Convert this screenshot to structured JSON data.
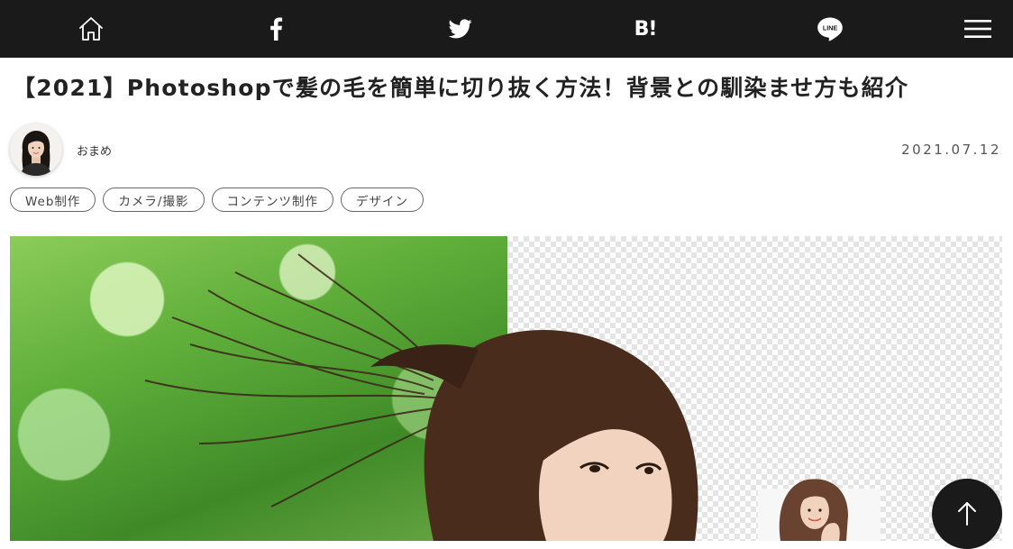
{
  "share_bar": {
    "background": "#1a1a1a",
    "items": [
      {
        "id": "home",
        "icon": "home-icon"
      },
      {
        "id": "facebook",
        "icon": "facebook-icon"
      },
      {
        "id": "twitter",
        "icon": "twitter-icon"
      },
      {
        "id": "hatena",
        "icon": "hatena-bookmark-icon",
        "label": "B!"
      },
      {
        "id": "line",
        "icon": "line-icon",
        "label": "LINE"
      },
      {
        "id": "menu",
        "icon": "hamburger-menu-icon"
      }
    ]
  },
  "article": {
    "title": "【2021】Photoshopで髪の毛を簡単に切り抜く方法！背景との馴染ませ方も紹介",
    "author": "おまめ",
    "date": "2021.07.12",
    "tags": [
      "Web制作",
      "カメラ/撮影",
      "コンテンツ制作",
      "デザイン"
    ]
  },
  "hero": {
    "left_panel": "green-bokeh-background",
    "right_panel": "transparent-checkerboard"
  },
  "scroll_top": {
    "icon": "arrow-up-icon"
  }
}
